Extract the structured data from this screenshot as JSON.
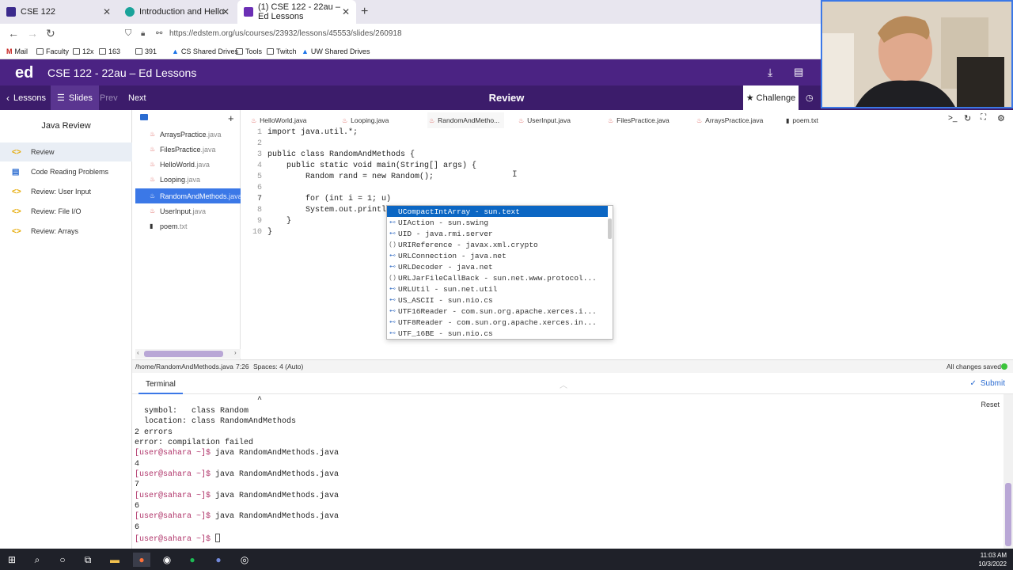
{
  "browser": {
    "tabs": [
      {
        "label": "CSE 122",
        "favicon_color": "#3b2a8c"
      },
      {
        "label": "Introduction and Hello World!",
        "favicon_color": "#1aa39a"
      },
      {
        "label": "(1) CSE 122 - 22au – Ed Lessons",
        "favicon_color": "#6b2fb5"
      }
    ],
    "new_tab": "+",
    "url": "https://edstem.org/us/courses/23932/lessons/45553/slides/260918",
    "bookmarks": [
      "Mail",
      "Faculty",
      "12x",
      "163",
      "391",
      "CS Shared Drives",
      "Tools",
      "Twitch",
      "UW Shared Drives"
    ]
  },
  "ed": {
    "logo": "ed",
    "title": "CSE 122 - 22au – Ed Lessons",
    "lessons_label": "Lessons",
    "slides_label": "Slides",
    "prev_label": "Prev",
    "next_label": "Next",
    "review_title": "Review",
    "challenge_label": "Challenge"
  },
  "sidebar": {
    "title": "Java Review",
    "items": [
      {
        "label": "Review",
        "icon": "code-icon"
      },
      {
        "label": "Code Reading Problems",
        "icon": "document-icon"
      },
      {
        "label": "Review: User Input",
        "icon": "code-icon"
      },
      {
        "label": "Review: File I/O",
        "icon": "code-icon"
      },
      {
        "label": "Review: Arrays",
        "icon": "code-icon"
      }
    ]
  },
  "files": [
    {
      "name": "ArraysPractice",
      "ext": ".java"
    },
    {
      "name": "FilesPractice",
      "ext": ".java"
    },
    {
      "name": "HelloWorld",
      "ext": ".java"
    },
    {
      "name": "Looping",
      "ext": ".java"
    },
    {
      "name": "RandomAndMethods",
      "ext": ".java"
    },
    {
      "name": "UserInput",
      "ext": ".java"
    },
    {
      "name": "poem",
      "ext": ".txt"
    }
  ],
  "editor_tabs": [
    "HelloWorld.java",
    "Looping.java",
    "RandomAndMetho...",
    "UserInput.java",
    "FilesPractice.java",
    "ArraysPractice.java",
    "poem.txt"
  ],
  "code_lines": [
    {
      "n": "1",
      "text": "import java.util.*;"
    },
    {
      "n": "2",
      "text": ""
    },
    {
      "n": "3",
      "text": "public class RandomAndMethods {"
    },
    {
      "n": "4",
      "text": "    public static void main(String[] args) {"
    },
    {
      "n": "5",
      "text": "        Random rand = new Random();"
    },
    {
      "n": "6",
      "text": ""
    },
    {
      "n": "7",
      "text": "        for (int i = 1; u)"
    },
    {
      "n": "8",
      "text": "        System.out.printl"
    },
    {
      "n": "9",
      "text": "    }"
    },
    {
      "n": "10",
      "text": "}"
    }
  ],
  "autocomplete": [
    "UCompactIntArray - sun.text",
    "UIAction - sun.swing",
    "UID - java.rmi.server",
    "URIReference - javax.xml.crypto",
    "URLConnection - java.net",
    "URLDecoder - java.net",
    "URLJarFileCallBack - sun.net.www.protocol...",
    "URLUtil - sun.net.util",
    "US_ASCII - sun.nio.cs",
    "UTF16Reader - com.sun.org.apache.xerces.i...",
    "UTF8Reader - com.sun.org.apache.xerces.in...",
    "UTF_16BE - sun.nio.cs"
  ],
  "status": {
    "path": "/home/RandomAndMethods.java",
    "position": "7:26",
    "spaces": "Spaces: 4 (Auto)",
    "saved": "All changes saved"
  },
  "terminal": {
    "tab": "Terminal",
    "submit_label": "Submit",
    "reset_label": "Reset",
    "caret": "^",
    "lines": [
      "  symbol:   class Random",
      "  location: class RandomAndMethods",
      "2 errors",
      "error: compilation failed"
    ],
    "prompt": "[user@sahara ~]$",
    "command": "java RandomAndMethods.java",
    "outputs": [
      "4",
      "7",
      "6",
      "6"
    ]
  },
  "taskbar": {
    "time": "11:03 AM",
    "date": "10/3/2022"
  }
}
